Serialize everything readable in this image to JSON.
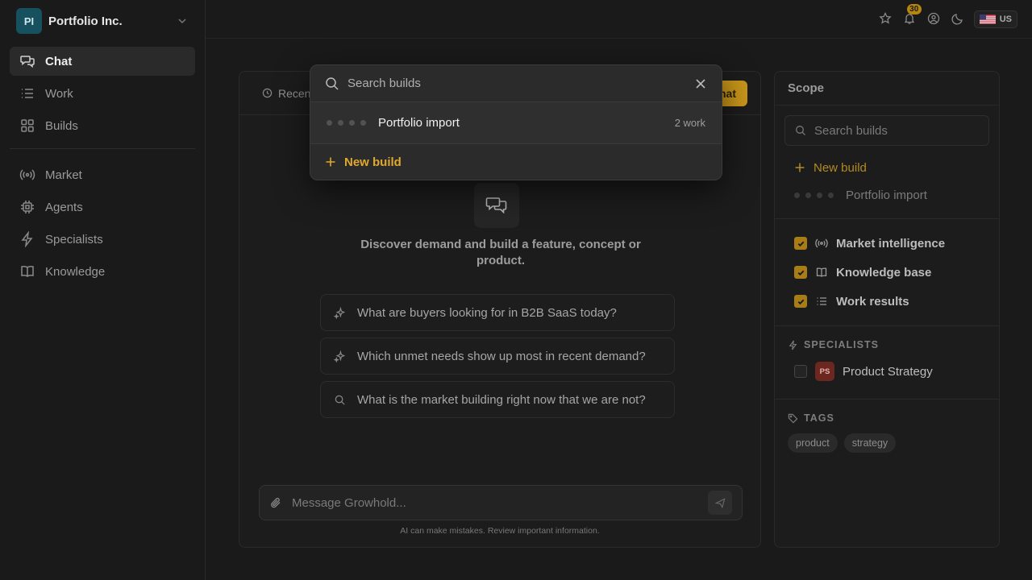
{
  "org": {
    "initials": "PI",
    "name": "Portfolio Inc."
  },
  "nav": {
    "items": [
      {
        "label": "Chat"
      },
      {
        "label": "Work"
      },
      {
        "label": "Builds"
      },
      {
        "label": "Market"
      },
      {
        "label": "Agents"
      },
      {
        "label": "Specialists"
      },
      {
        "label": "Knowledge"
      }
    ]
  },
  "topbar": {
    "notifications": "30",
    "language": "US"
  },
  "chat": {
    "recent_label": "Recen",
    "new_chat_label": "hat",
    "welcome": "Discover demand and build a feature, concept or product.",
    "suggestions": [
      "What are buyers looking for in B2B SaaS today?",
      "Which unmet needs show up most in recent demand?",
      "What is the market building right now that we are not?"
    ],
    "composer_placeholder": "Message Growhold...",
    "disclaimer": "AI can make mistakes. Review important information."
  },
  "scope": {
    "title": "Scope",
    "search_placeholder": "Search builds",
    "new_build": "New build",
    "build_name": "Portfolio import",
    "checks": [
      {
        "label": "Market intelligence",
        "icon": "broadcast-icon"
      },
      {
        "label": "Knowledge base",
        "icon": "book-icon"
      },
      {
        "label": "Work results",
        "icon": "list-icon"
      }
    ],
    "specialists_label": "SPECIALISTS",
    "specialist": {
      "initials": "PS",
      "name": "Product Strategy"
    },
    "tags_label": "TAGS",
    "tags": [
      "product",
      "strategy"
    ]
  },
  "modal": {
    "search_placeholder": "Search builds",
    "build_name": "Portfolio import",
    "build_count": "2 work",
    "new_build": "New build"
  },
  "colors": {
    "accent": "#c9961a",
    "background": "#1a1a1a"
  }
}
